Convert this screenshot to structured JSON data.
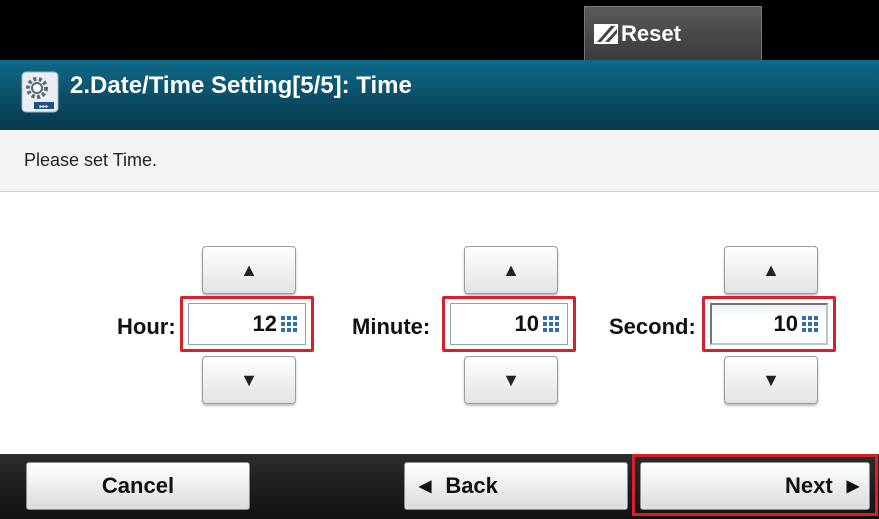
{
  "header": {
    "reset_label": "Reset"
  },
  "titlebar": {
    "title": "2.Date/Time Setting[5/5]: Time"
  },
  "instruction": "Please set Time.",
  "fields": {
    "hour": {
      "label": "Hour:",
      "value": "12"
    },
    "minute": {
      "label": "Minute:",
      "value": "10"
    },
    "second": {
      "label": "Second:",
      "value": "10"
    }
  },
  "footer": {
    "cancel_label": "Cancel",
    "back_label": "Back",
    "next_label": "Next"
  },
  "colors": {
    "title_bar": "#0b4c65",
    "highlight": "#d6202a",
    "keypad_icon": "#2f6fb0"
  }
}
